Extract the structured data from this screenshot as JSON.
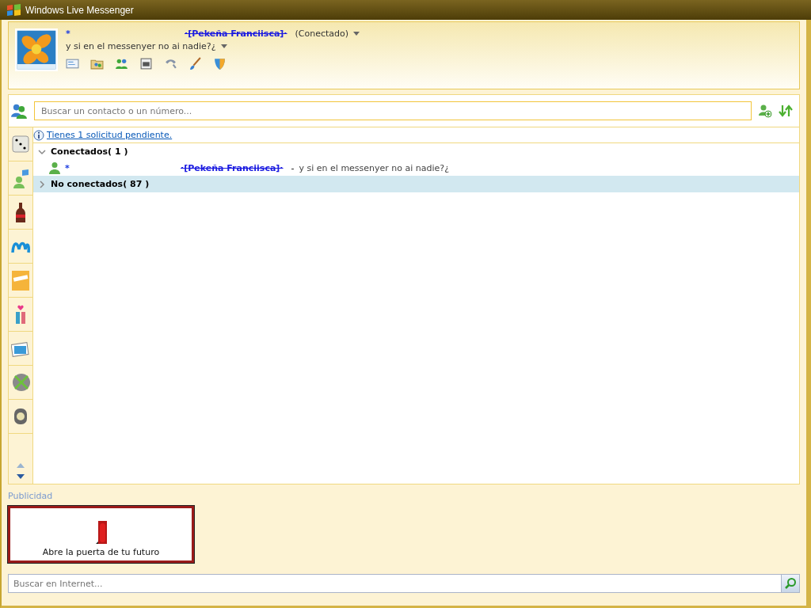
{
  "window": {
    "title": "Windows Live Messenger"
  },
  "profile": {
    "prefix": "*",
    "name": "·[Pekeña Franciisca]·",
    "status": "(Conectado)",
    "message": "y si en el messenyer no ai nadie?¿"
  },
  "contact_search": {
    "placeholder": "Buscar un contacto o un número..."
  },
  "notice": {
    "link": "Tienes 1 solicitud pendiente."
  },
  "groups": [
    {
      "name": "Conectados",
      "count": "( 1 )",
      "expanded": true,
      "selected": false,
      "contacts": [
        {
          "prefix": "*",
          "name": "·[Pekeña Franciisca]·",
          "separator": "-",
          "message": "y si en el messenyer no ai nadie?¿"
        }
      ]
    },
    {
      "name": "No conectados",
      "count": "( 87 )",
      "expanded": false,
      "selected": true
    }
  ],
  "ad": {
    "label": "Publicidad",
    "text": "Abre la puerta de tu futuro"
  },
  "internet_search": {
    "placeholder": "Buscar en Internet..."
  }
}
